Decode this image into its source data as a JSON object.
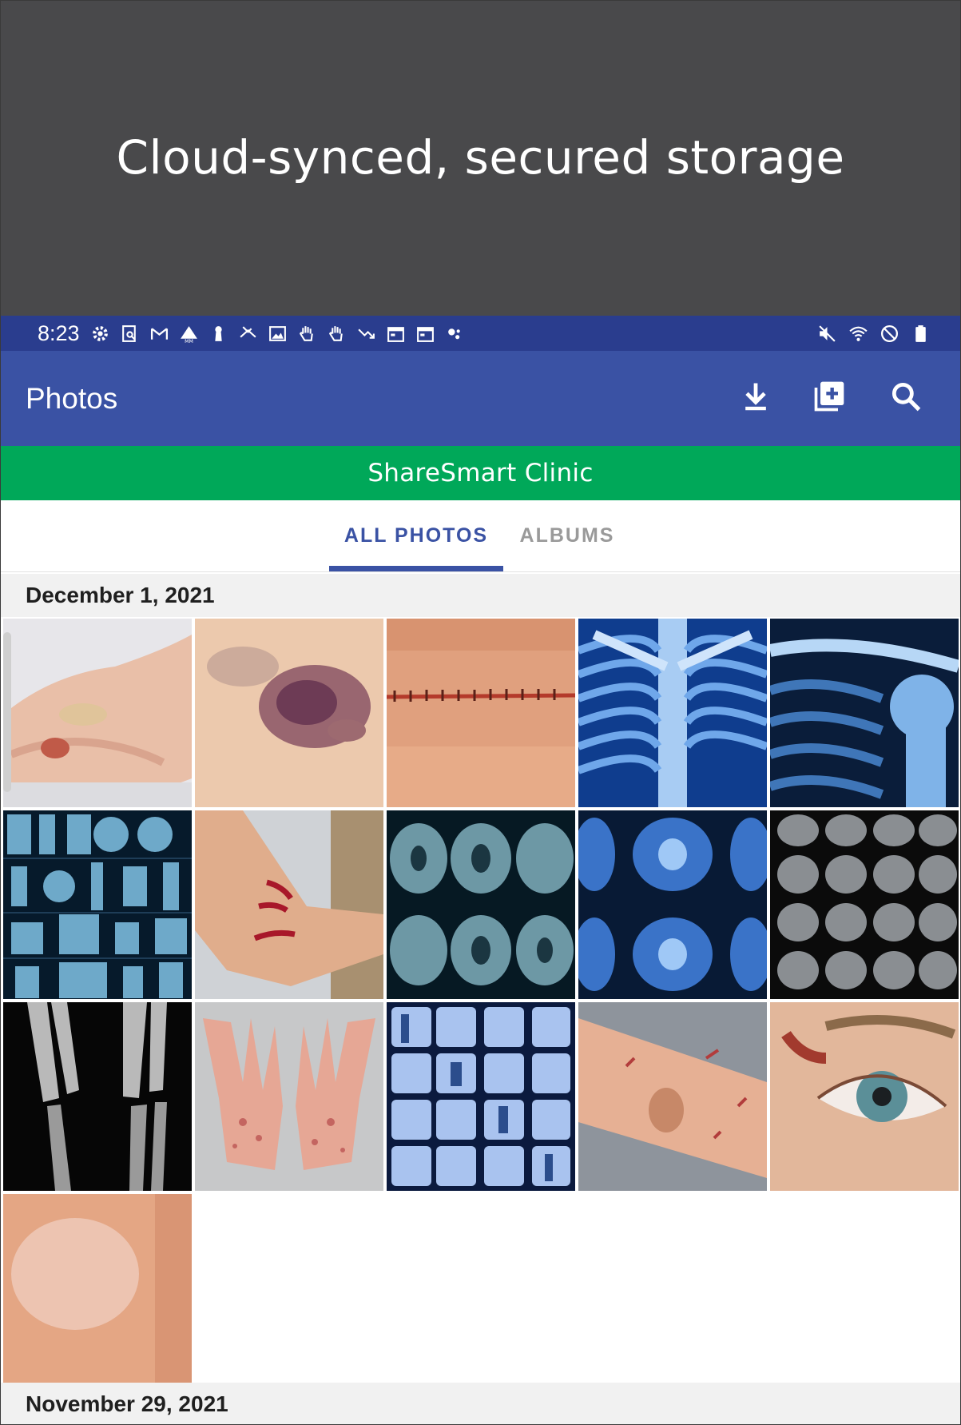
{
  "banner": {
    "text": "Cloud-synced, secured storage"
  },
  "status_bar": {
    "time": "8:23",
    "left_icons": [
      "gear-icon",
      "screenshot-search-icon",
      "gmail-icon",
      "drive-warning-icon",
      "keyhole-icon",
      "missed-call-icon",
      "image-icon",
      "hand-icon",
      "hand-icon",
      "trend-down-icon",
      "calendar-icon",
      "calendar-icon",
      "dots-icon"
    ],
    "right_icons": [
      "mute-icon",
      "wifi-icon",
      "do-not-disturb-icon",
      "battery-icon"
    ]
  },
  "app_bar": {
    "title": "Photos",
    "actions": [
      "download-icon",
      "add-album-icon",
      "search-icon"
    ],
    "color": "#3a52a4"
  },
  "clinic_bar": {
    "name": "ShareSmart Clinic",
    "color": "#00a859"
  },
  "tabs": [
    {
      "label": "ALL PHOTOS",
      "selected": true
    },
    {
      "label": "ALBUMS",
      "selected": false
    }
  ],
  "sections": [
    {
      "date": "December 1, 2021",
      "photos": [
        {
          "subject": "foot wound"
        },
        {
          "subject": "bruise"
        },
        {
          "subject": "stitched incision"
        },
        {
          "subject": "chest x-ray"
        },
        {
          "subject": "shoulder x-ray"
        },
        {
          "subject": "x-ray collage"
        },
        {
          "subject": "hand laceration"
        },
        {
          "subject": "brain mri coronal"
        },
        {
          "subject": "brain mri axial"
        },
        {
          "subject": "brain mri series"
        },
        {
          "subject": "forearm fracture x-ray"
        },
        {
          "subject": "hand rash"
        },
        {
          "subject": "x-ray collage blue"
        },
        {
          "subject": "arm scratches"
        },
        {
          "subject": "eye abrasion"
        },
        {
          "subject": "skin patch"
        }
      ]
    },
    {
      "date": "November 29, 2021",
      "photos": []
    }
  ]
}
